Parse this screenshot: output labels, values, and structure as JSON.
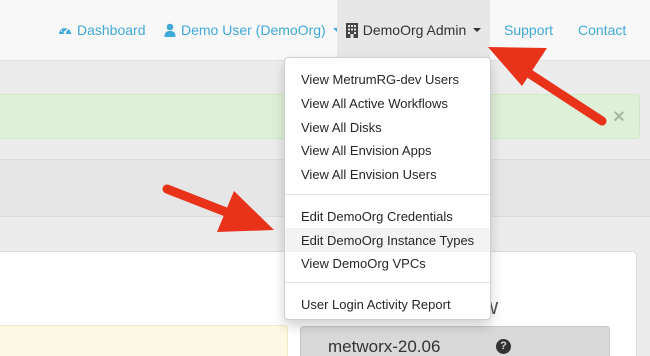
{
  "navbar": {
    "dashboard": {
      "label": "Dashboard",
      "icon": "tachometer-icon"
    },
    "user": {
      "label": "Demo User (DemoOrg)",
      "icon": "user-icon"
    },
    "admin": {
      "label": "DemoOrg Admin",
      "icon": "building-icon"
    },
    "support": {
      "label": "Support"
    },
    "contact": {
      "label": "Contact"
    },
    "link_color": "#3fa9d7"
  },
  "alert": {
    "close_label": "×",
    "color": "#dff0d8"
  },
  "admin_menu": {
    "items": [
      {
        "label": "View MetrumRG-dev Users"
      },
      {
        "label": "View All Active Workflows"
      },
      {
        "label": "View All Disks"
      },
      {
        "label": "View All Envision Apps"
      },
      {
        "label": "View All Envision Users"
      },
      {
        "label": "Edit DemoOrg Credentials"
      },
      {
        "label": "Edit DemoOrg Instance Types"
      },
      {
        "label": "View DemoOrg VPCs"
      },
      {
        "label": "User Login Activity Report"
      }
    ]
  },
  "panel": {
    "heading_fragment": "ow",
    "version": {
      "value": "metworx-20.06",
      "help_icon": "question-circle-icon"
    }
  },
  "annotation": {
    "arrow_color": "#e8321a"
  }
}
